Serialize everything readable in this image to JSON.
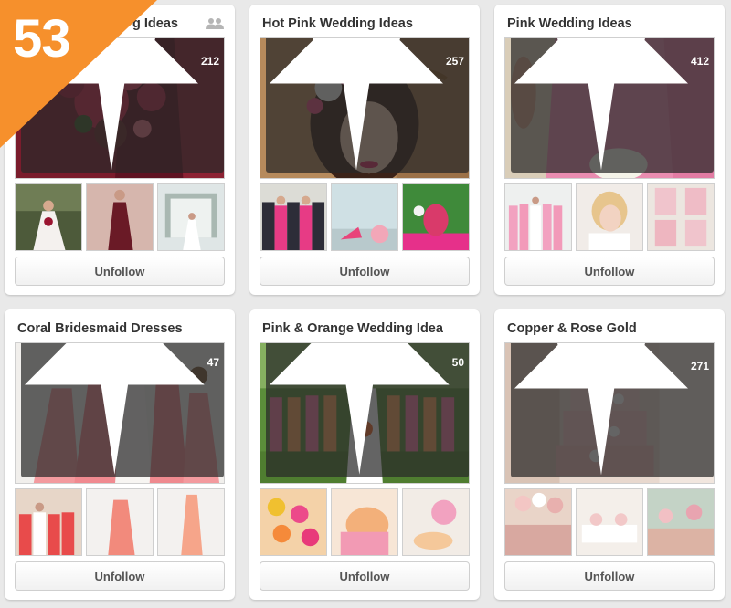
{
  "badge": {
    "number": "53",
    "color": "#f6902c"
  },
  "button_label": "Unfollow",
  "boards": [
    {
      "title": "Burgundy Wedding Ideas",
      "visible_title": "g Ideas",
      "pins": "212",
      "group_board": true
    },
    {
      "title": "Hot Pink Wedding Ideas",
      "pins": "257",
      "group_board": false
    },
    {
      "title": "Pink Wedding Ideas",
      "pins": "412",
      "group_board": false
    },
    {
      "title": "Coral Bridesmaid Dresses",
      "pins": "47",
      "group_board": false
    },
    {
      "title": "Pink & Orange Wedding Ideas",
      "pins": "50",
      "group_board": false
    },
    {
      "title": "Copper & Rose Gold",
      "pins": "271",
      "group_board": false
    }
  ],
  "icons": {
    "pin": "pushpin-icon",
    "group": "group-board-icon"
  }
}
